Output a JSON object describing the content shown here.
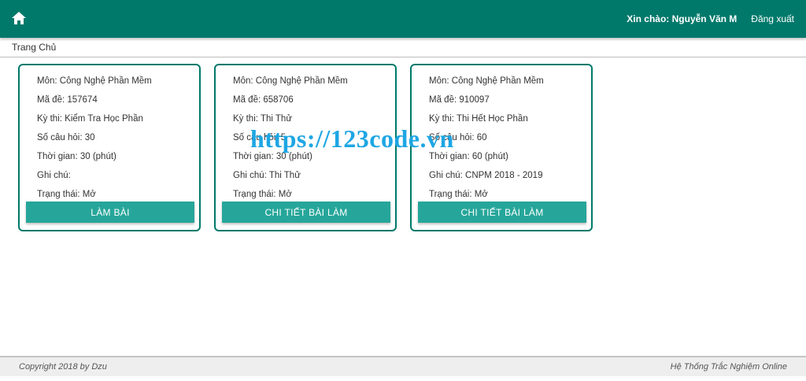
{
  "navbar": {
    "home_icon": "home-icon",
    "greeting": "Xin chào: Nguyễn Văn M",
    "logout": "Đăng xuất"
  },
  "breadcrumb": "Trang Chủ",
  "cards": [
    {
      "lines": [
        "Môn: Công Nghệ Phần Mềm",
        "Mã đề: 157674",
        "Kỳ thi: Kiểm Tra Học Phần",
        "Số câu hỏi: 30",
        "Thời gian: 30 (phút)",
        "Ghi chú:",
        "Trạng thái: Mở"
      ],
      "button": "LÀM BÀI"
    },
    {
      "lines": [
        "Môn: Công Nghệ Phần Mềm",
        "Mã đề: 658706",
        "Kỳ thi: Thi Thử",
        "Số câu hỏi: 5",
        "Thời gian: 30 (phút)",
        "Ghi chú: Thi Thử",
        "Trạng thái: Mở"
      ],
      "button": "CHI TIẾT BÀI LÀM"
    },
    {
      "lines": [
        "Môn: Công Nghệ Phần Mềm",
        "Mã đề: 910097",
        "Kỳ thi: Thi Hết Học Phần",
        "Số câu hỏi: 60",
        "Thời gian: 60 (phút)",
        "Ghi chú: CNPM 2018 - 2019",
        "Trạng thái: Mở"
      ],
      "button": "CHI TIẾT BÀI LÀM"
    }
  ],
  "watermark": "https://123code.vn",
  "footer": {
    "copyright": "Copyright 2018 by Dzu",
    "system_name": "Hệ Thống Trắc Nghiệm Online"
  },
  "colors": {
    "navbar": "#00796b",
    "button": "#26a69a",
    "watermark": "#1ea6e4"
  }
}
